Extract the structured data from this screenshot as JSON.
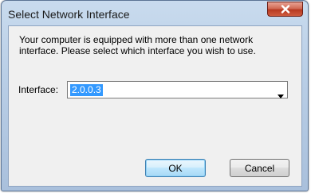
{
  "window": {
    "title": "Select Network Interface"
  },
  "message": {
    "line1": "Your computer is equipped with more than one network",
    "line2": "interface. Please select which interface you wish to use."
  },
  "interface": {
    "label": "Interface:",
    "selected_value": "2.0.0.3"
  },
  "buttons": {
    "ok": "OK",
    "cancel": "Cancel"
  },
  "icons": {
    "close": "close-icon",
    "dropdown": "chevron-down-icon"
  },
  "colors": {
    "selection_highlight": "#3399ff",
    "close_button": "#c7472d",
    "titlebar": "#b9cee6"
  }
}
